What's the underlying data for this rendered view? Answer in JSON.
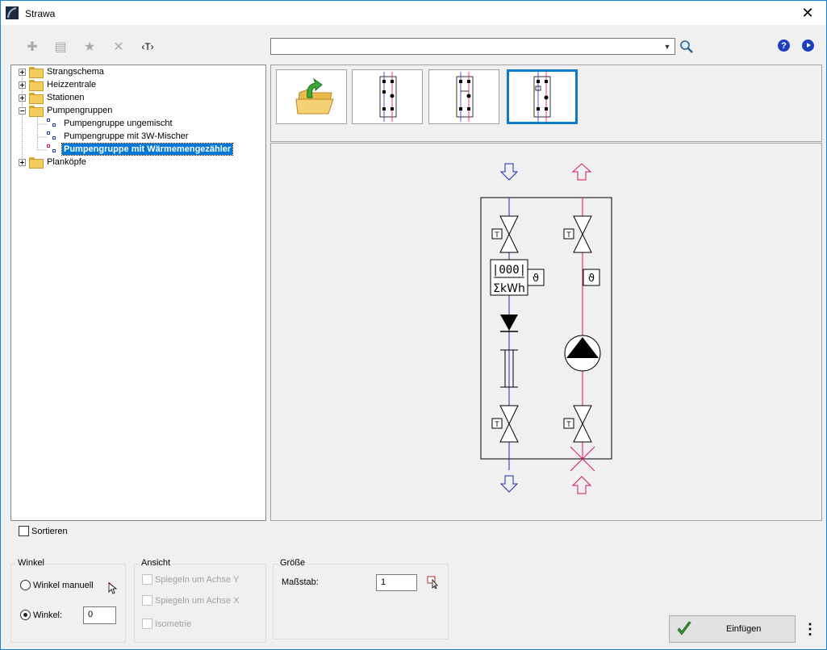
{
  "window": {
    "title": "Strawa",
    "close_glyph": "✕"
  },
  "toolbar": {
    "buttons": [
      {
        "name": "add-icon",
        "glyph": "✚"
      },
      {
        "name": "list-icon",
        "glyph": "▤"
      },
      {
        "name": "favorite-star-icon",
        "glyph": "★"
      },
      {
        "name": "delete-cross-icon",
        "glyph": "✕"
      },
      {
        "name": "text-tag-icon",
        "glyph": "‹T›"
      }
    ],
    "search_value": "",
    "help_glyph": "?"
  },
  "tree": {
    "items": [
      {
        "label": "Strangschema",
        "expanded": false
      },
      {
        "label": "Heizzentrale",
        "expanded": false
      },
      {
        "label": "Stationen",
        "expanded": false
      },
      {
        "label": "Pumpengruppen",
        "expanded": true
      },
      {
        "label": "Pumpengruppe ungemischt"
      },
      {
        "label": "Pumpengruppe mit 3W-Mischer"
      },
      {
        "label": "Pumpengruppe mit Wärmemengezähler",
        "selected": true
      },
      {
        "label": "Planköpfe",
        "expanded": false
      }
    ]
  },
  "thumbnails": {
    "count": 4,
    "selected_index": 3
  },
  "preview": {
    "meter_line1": "|000|",
    "meter_line2": "ΣkWh",
    "valve_tag": "T",
    "flow_color": "#1c2bb8",
    "return_color": "#d4126b"
  },
  "sort": {
    "label": "Sortieren",
    "checked": false
  },
  "winkel": {
    "title": "Winkel",
    "manual_label": "Winkel manuell",
    "angle_label": "Winkel:",
    "angle_value": "0",
    "selected": "angle"
  },
  "ansicht": {
    "title": "Ansicht",
    "mirror_y": "Spiegeln um Achse Y",
    "mirror_x": "Spiegeln um Achse X",
    "isometric": "Isometrie"
  },
  "groesse": {
    "title": "Größe",
    "scale_label": "Maßstab:",
    "scale_value": "1"
  },
  "actions": {
    "insert_label": "Einfügen",
    "more_glyph": "⋮"
  }
}
